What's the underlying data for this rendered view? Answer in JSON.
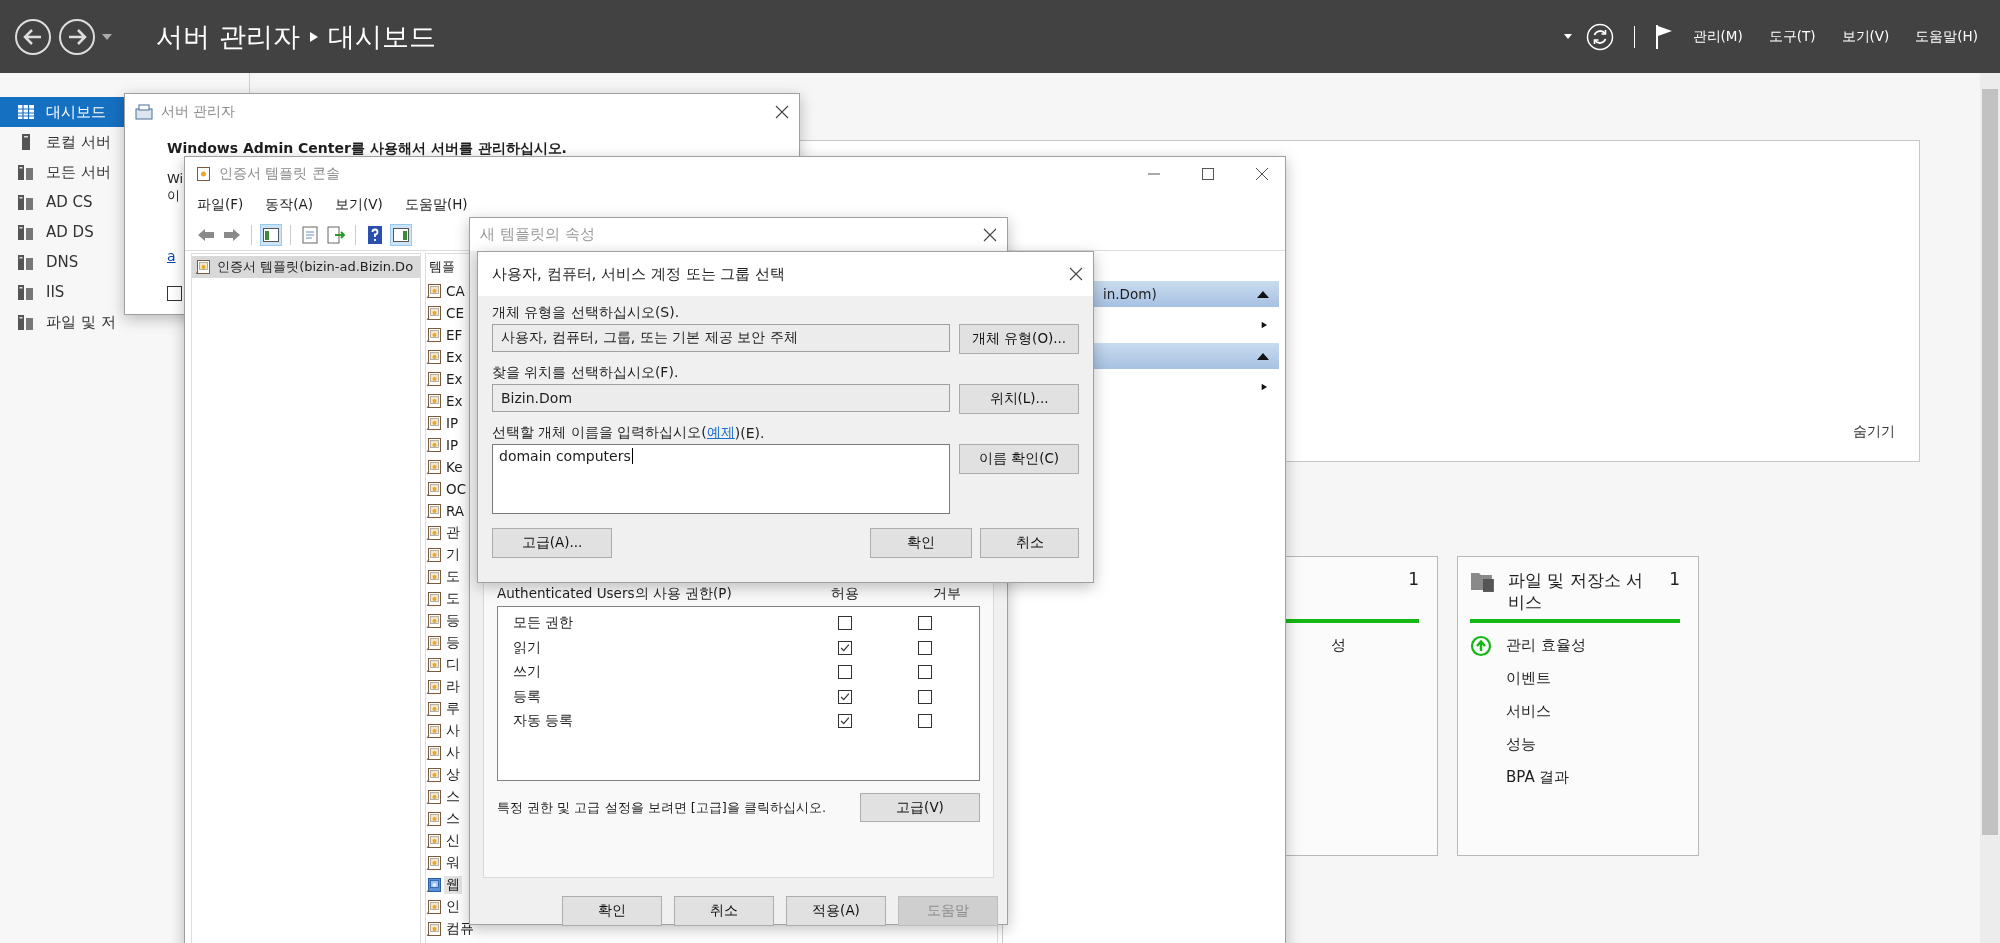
{
  "header": {
    "app_title": "서버 관리자",
    "page_title": "대시보드",
    "menus": [
      "관리(M)",
      "도구(T)",
      "보기(V)",
      "도움말(H)"
    ]
  },
  "sidebar": {
    "items": [
      {
        "label": "대시보드",
        "selected": true
      },
      {
        "label": "로컬 서버",
        "selected": false
      },
      {
        "label": "모든 서버",
        "selected": false
      },
      {
        "label": "AD CS",
        "selected": false
      },
      {
        "label": "AD DS",
        "selected": false
      },
      {
        "label": "DNS",
        "selected": false
      },
      {
        "label": "IIS",
        "selected": false
      },
      {
        "label": "파일 및 저",
        "selected": false
      }
    ]
  },
  "dashboard": {
    "hide_link": "숨기기",
    "tiles": [
      {
        "count": "1",
        "rows": [
          {
            "label": "성",
            "kind": "plain"
          }
        ]
      },
      {
        "title": "파일 및 저장소 서비스",
        "count": "1",
        "rows": [
          {
            "label": "관리 효율성",
            "kind": "status"
          },
          {
            "label": "이벤트",
            "kind": "plain"
          },
          {
            "label": "서비스",
            "kind": "plain"
          },
          {
            "label": "성능",
            "kind": "plain"
          },
          {
            "label": "BPA 결과",
            "kind": "plain"
          }
        ]
      }
    ]
  },
  "server_manager_popup": {
    "title": "서버 관리자",
    "heading": "Windows Admin Center를 사용해서 서버를 관리하십시오.",
    "fragments": [
      "Wi",
      "이"
    ],
    "link": "a",
    "checkbox_checked": false
  },
  "console": {
    "title": "인증서 템플릿 콘솔",
    "menus": [
      "파일(F)",
      "동작(A)",
      "보기(V)",
      "도움말(H)"
    ],
    "tree": [
      {
        "label": "인증서 템플릿(bizin-ad.Bizin.Do",
        "selected": true
      }
    ],
    "list_header": "템플",
    "templates": [
      {
        "label": "CA",
        "selected": false
      },
      {
        "label": "CE",
        "selected": false
      },
      {
        "label": "EF",
        "selected": false
      },
      {
        "label": "Ex",
        "selected": false
      },
      {
        "label": "Ex",
        "selected": false
      },
      {
        "label": "Ex",
        "selected": false
      },
      {
        "label": "IP",
        "selected": false
      },
      {
        "label": "IP",
        "selected": false
      },
      {
        "label": "Ke",
        "selected": false
      },
      {
        "label": "OC",
        "selected": false
      },
      {
        "label": "RA",
        "selected": false
      },
      {
        "label": "관",
        "selected": false
      },
      {
        "label": "기",
        "selected": false
      },
      {
        "label": "도",
        "selected": false
      },
      {
        "label": "도",
        "selected": false
      },
      {
        "label": "등",
        "selected": false
      },
      {
        "label": "등",
        "selected": false
      },
      {
        "label": "디",
        "selected": false
      },
      {
        "label": "라",
        "selected": false
      },
      {
        "label": "루",
        "selected": false
      },
      {
        "label": "사",
        "selected": false
      },
      {
        "label": "사",
        "selected": false
      },
      {
        "label": "상",
        "selected": false
      },
      {
        "label": "스",
        "selected": false
      },
      {
        "label": "스",
        "selected": false
      },
      {
        "label": "신",
        "selected": false
      },
      {
        "label": "워",
        "selected": false
      },
      {
        "label": "웹",
        "selected": true
      },
      {
        "label": "인",
        "selected": false
      },
      {
        "label": "컴퓨",
        "selected": false
      }
    ],
    "actions": [
      {
        "kind": "header",
        "label": "in.Dom)"
      },
      {
        "kind": "item"
      },
      {
        "kind": "header"
      },
      {
        "kind": "item"
      }
    ]
  },
  "properties_dialog": {
    "title": "새 템플릿의 속성",
    "permissions_label": "Authenticated Users의 사용 권한(P)",
    "allow_header": "허용",
    "deny_header": "거부",
    "permissions": [
      {
        "name": "모든 권한",
        "allow": false,
        "deny": false
      },
      {
        "name": "읽기",
        "allow": true,
        "deny": false
      },
      {
        "name": "쓰기",
        "allow": false,
        "deny": false
      },
      {
        "name": "등록",
        "allow": true,
        "deny": false
      },
      {
        "name": "자동 등록",
        "allow": true,
        "deny": false
      }
    ],
    "note": "특정 권한 및 고급 설정을 보려면 [고급]을 클릭하십시오.",
    "advanced_button": "고급(V)",
    "buttons": [
      {
        "label": "확인",
        "disabled": false
      },
      {
        "label": "취소",
        "disabled": false
      },
      {
        "label": "적용(A)",
        "disabled": false
      },
      {
        "label": "도움말",
        "disabled": true
      }
    ]
  },
  "select_dialog": {
    "title": "사용자, 컴퓨터, 서비스 계정 또는 그룹 선택",
    "object_type_label": "개체 유형을 선택하십시오(S).",
    "object_type": "사용자, 컴퓨터, 그룹, 또는 기본 제공 보안 주체",
    "object_type_button": "개체 유형(O)...",
    "location_label": "찾을 위치를 선택하십시오(F).",
    "location": "Bizin.Dom",
    "location_button": "위치(L)...",
    "names_label": {
      "before": "선택할 개체 이름을 입력하십시오(",
      "link": "예제",
      "after": ")(E)."
    },
    "names_value": "domain computers",
    "check_names_button": "이름 확인(C)",
    "advanced_button": "고급(A)...",
    "ok_button": "확인",
    "cancel_button": "취소"
  }
}
